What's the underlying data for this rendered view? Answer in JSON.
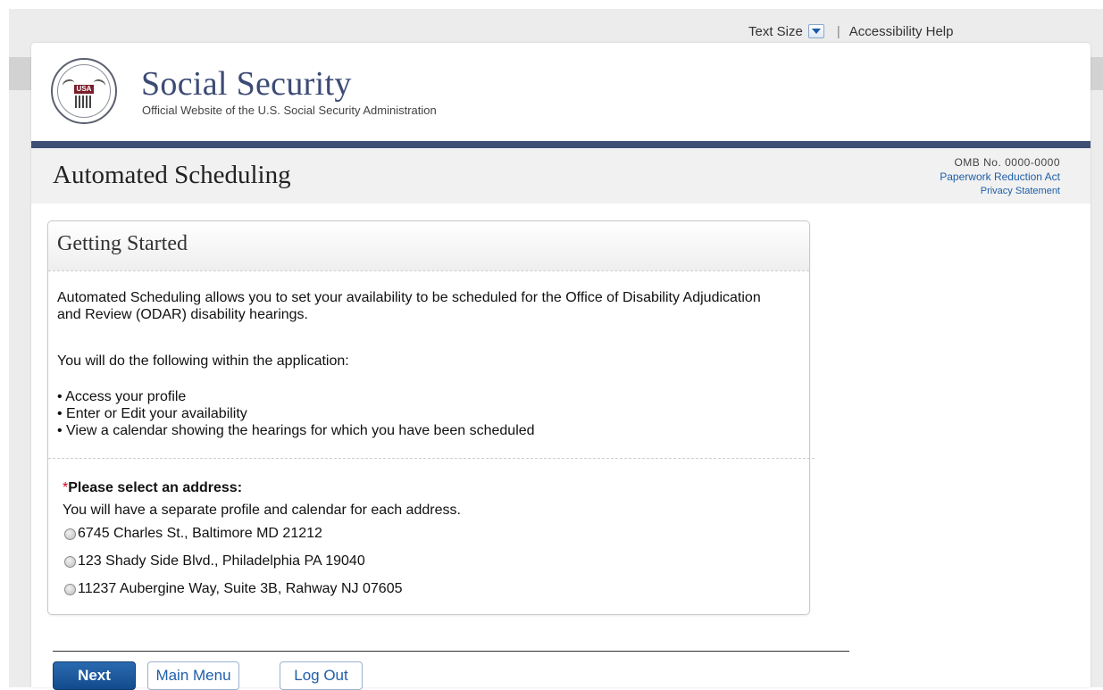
{
  "utility": {
    "text_size_label": "Text Size",
    "accessibility_help": "Accessibility Help"
  },
  "header": {
    "logo_text": "SOCIAL SECURITY ADMINISTRATION USA",
    "title": "Social Security",
    "subtitle": "Official Website of the U.S. Social Security Administration"
  },
  "titlebar": {
    "app_title": "Automated Scheduling",
    "omb_number": "OMB No. 0000-0000",
    "paperwork_link": "Paperwork Reduction Act",
    "privacy_link": "Privacy Statement"
  },
  "panel": {
    "title": "Getting Started",
    "intro": "Automated Scheduling allows you to set your availability to be scheduled for the Office of Disability Adjudication and Review (ODAR) disability hearings.",
    "follow": "You will do the following within the application:",
    "bullets": [
      "• Access your profile",
      "• Enter or Edit your availability",
      "• View a calendar showing the hearings for which you have been scheduled"
    ],
    "address_required_mark": "*",
    "address_label": "Please select an address:",
    "address_note": "You will have a separate profile and calendar for each address.",
    "addresses": [
      "6745 Charles St., Baltimore MD 21212",
      "123 Shady Side Blvd., Philadelphia PA 19040",
      "11237 Aubergine Way, Suite 3B, Rahway NJ 07605"
    ]
  },
  "buttons": {
    "next": "Next",
    "main_menu": "Main Menu",
    "log_out": "Log Out"
  },
  "colors": {
    "brand_navy": "#3e4e75",
    "link_blue": "#1f5ea8",
    "next_button": "#124b8c",
    "required_red": "#d0021b"
  }
}
